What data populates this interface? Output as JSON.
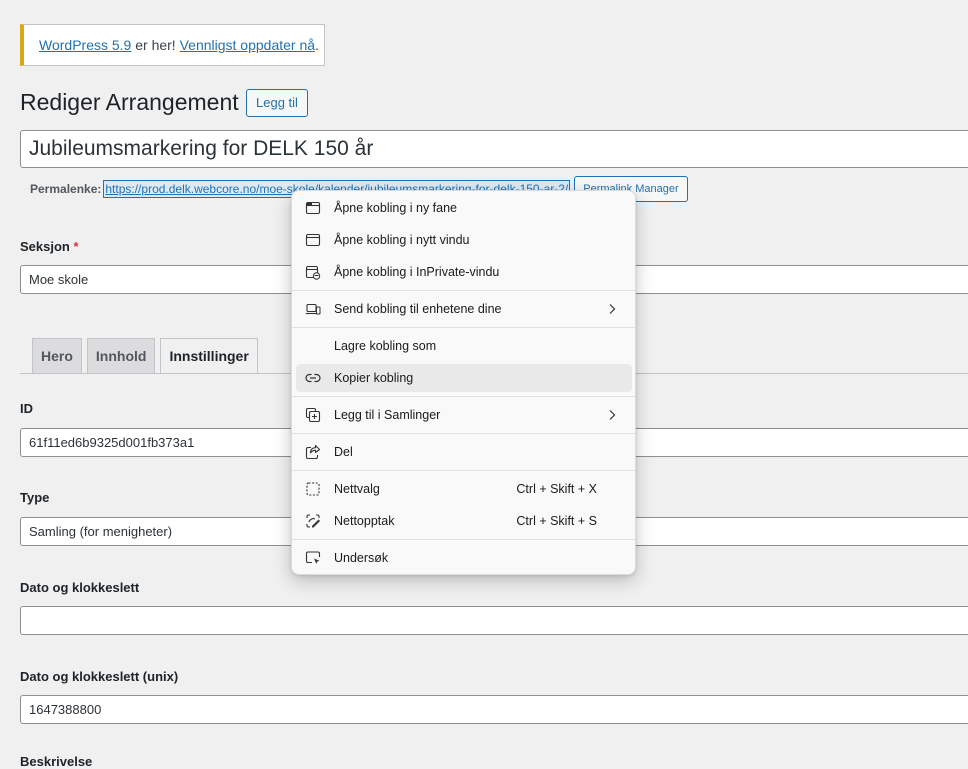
{
  "notice": {
    "version_link": "WordPress 5.9",
    "middle": " er her! ",
    "update_link": "Vennligst oppdater nå",
    "end": "."
  },
  "header": {
    "title": "Rediger Arrangement",
    "add_button": "Legg til"
  },
  "post_title": "Jubileumsmarkering for DELK 150 år",
  "permalink": {
    "label": "Permalenke:",
    "url": "https://prod.delk.webcore.no/moe-skole/kalender/jubileumsmarkering-for-delk-150-ar-2/",
    "manager_button": "Permalink Manager"
  },
  "fields": {
    "seksjon": {
      "label": "Seksjon",
      "required_mark": "*",
      "value": "Moe skole"
    },
    "id": {
      "label": "ID",
      "value": "61f11ed6b9325d001fb373a1"
    },
    "type": {
      "label": "Type",
      "value": "Samling (for menigheter)"
    },
    "dato": {
      "label": "Dato og klokkeslett",
      "value": ""
    },
    "dato_unix": {
      "label": "Dato og klokkeslett (unix)",
      "value": "1647388800"
    },
    "next_label": "Beskrivelse"
  },
  "tabs": [
    {
      "label": "Hero",
      "active": false
    },
    {
      "label": "Innhold",
      "active": false
    },
    {
      "label": "Innstillinger",
      "active": true
    }
  ],
  "context_menu": {
    "items": [
      {
        "label": "Åpne kobling i ny fane",
        "icon": "new-tab-icon"
      },
      {
        "label": "Åpne kobling i nytt vindu",
        "icon": "new-window-icon"
      },
      {
        "label": "Åpne kobling i InPrivate-vindu",
        "icon": "inprivate-icon"
      },
      {
        "label": "Send kobling til enhetene dine",
        "icon": "devices-icon",
        "submenu": true
      },
      {
        "label": "Lagre kobling som",
        "icon": ""
      },
      {
        "label": "Kopier kobling",
        "icon": "link-icon",
        "hovered": true
      },
      {
        "label": "Legg til i Samlinger",
        "icon": "collections-icon",
        "submenu": true
      },
      {
        "label": "Del",
        "icon": "share-icon"
      },
      {
        "label": "Nettvalg",
        "icon": "web-select-icon",
        "shortcut": "Ctrl + Skift + X"
      },
      {
        "label": "Nettopptak",
        "icon": "web-capture-icon",
        "shortcut": "Ctrl + Skift + S"
      },
      {
        "label": "Undersøk",
        "icon": "inspect-icon"
      }
    ]
  }
}
